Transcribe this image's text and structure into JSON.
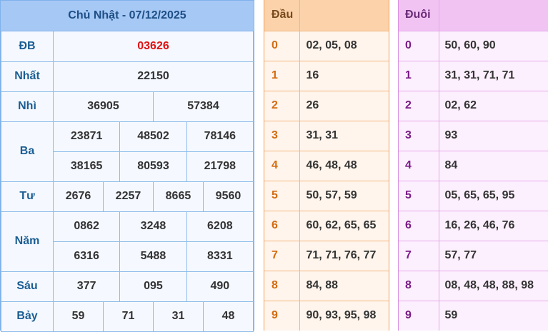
{
  "results": {
    "title": "Chủ Nhật - 07/12/2025",
    "db": {
      "label": "ĐB",
      "value": "03626"
    },
    "nhat": {
      "label": "Nhất",
      "value": "22150"
    },
    "nhi": {
      "label": "Nhì",
      "values": [
        "36905",
        "57384"
      ]
    },
    "ba": {
      "label": "Ba",
      "values": [
        "23871",
        "48502",
        "78146",
        "38165",
        "80593",
        "21798"
      ]
    },
    "tu": {
      "label": "Tư",
      "values": [
        "2676",
        "2257",
        "8665",
        "9560"
      ]
    },
    "nam": {
      "label": "Năm",
      "values": [
        "0862",
        "3248",
        "6208",
        "6316",
        "5488",
        "8331"
      ]
    },
    "sau": {
      "label": "Sáu",
      "values": [
        "377",
        "095",
        "490"
      ]
    },
    "bay": {
      "label": "Bảy",
      "values": [
        "59",
        "71",
        "31",
        "48"
      ]
    }
  },
  "head": {
    "title": "Đầu",
    "rows": [
      {
        "digit": "0",
        "numbers": "02, 05, 08"
      },
      {
        "digit": "1",
        "numbers": "16"
      },
      {
        "digit": "2",
        "numbers": "26"
      },
      {
        "digit": "3",
        "numbers": "31, 31"
      },
      {
        "digit": "4",
        "numbers": "46, 48, 48"
      },
      {
        "digit": "5",
        "numbers": "50, 57, 59"
      },
      {
        "digit": "6",
        "numbers": "60, 62, 65, 65"
      },
      {
        "digit": "7",
        "numbers": "71, 71, 76, 77"
      },
      {
        "digit": "8",
        "numbers": "84, 88"
      },
      {
        "digit": "9",
        "numbers": "90, 93, 95, 98"
      }
    ]
  },
  "tail": {
    "title": "Đuôi",
    "rows": [
      {
        "digit": "0",
        "numbers": "50, 60, 90"
      },
      {
        "digit": "1",
        "numbers": "31, 31, 71, 71"
      },
      {
        "digit": "2",
        "numbers": "02, 62"
      },
      {
        "digit": "3",
        "numbers": "93"
      },
      {
        "digit": "4",
        "numbers": "84"
      },
      {
        "digit": "5",
        "numbers": "05, 65, 65, 95"
      },
      {
        "digit": "6",
        "numbers": "16, 26, 46, 76"
      },
      {
        "digit": "7",
        "numbers": "57, 77"
      },
      {
        "digit": "8",
        "numbers": "08, 48, 48, 88, 98"
      },
      {
        "digit": "9",
        "numbers": "59"
      }
    ]
  },
  "colors": {
    "special_prize": "#e01010",
    "results_header": "#a6c8f5",
    "head_header": "#fbd2aa",
    "tail_header": "#f1c3f3"
  }
}
